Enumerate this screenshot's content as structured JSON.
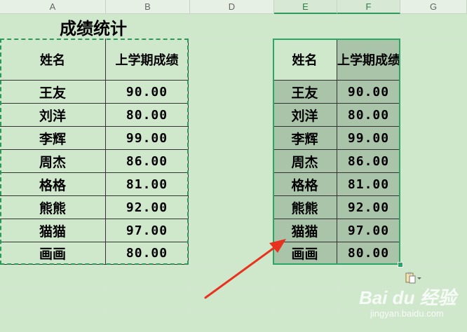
{
  "columns": [
    "A",
    "B",
    "",
    "D",
    "E",
    "F",
    "G"
  ],
  "title": "成绩统计",
  "header": {
    "name": "姓名",
    "score": "上学期成绩"
  },
  "rows": [
    {
      "name": "王友",
      "score": "90.00"
    },
    {
      "name": "刘洋",
      "score": "80.00"
    },
    {
      "name": "李辉",
      "score": "99.00"
    },
    {
      "name": "周杰",
      "score": "86.00"
    },
    {
      "name": "格格",
      "score": "81.00"
    },
    {
      "name": "熊熊",
      "score": "92.00"
    },
    {
      "name": "猫猫",
      "score": "97.00"
    },
    {
      "name": "画画",
      "score": "80.00"
    }
  ],
  "watermark": {
    "logo": "Bai du 经验",
    "sub": "jingyan.baidu.com"
  },
  "colors": {
    "background": "#cfe8cc",
    "selection": "#2aa665",
    "arrow": "#e8321f",
    "selected_fill": "#aac4a9"
  },
  "icons": {
    "paste_options": "paste-options-icon",
    "arrow": "red-arrow-annotation"
  }
}
